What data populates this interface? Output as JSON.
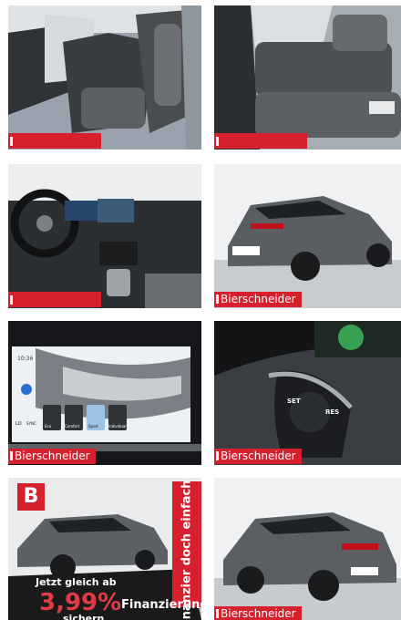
{
  "gallery": {
    "dealer_badge": "Bierschneider",
    "tiles": [
      {
        "name": "front-seats-photo",
        "badge": ""
      },
      {
        "name": "rear-seats-photo",
        "badge": ""
      },
      {
        "name": "dashboard-photo",
        "badge": ""
      },
      {
        "name": "car-rear-exterior-photo",
        "badge": "Bierschneider"
      },
      {
        "name": "infotainment-screen-photo",
        "badge": "Bierschneider"
      },
      {
        "name": "steering-wheel-buttons-photo",
        "badge": "Bierschneider"
      },
      {
        "name": "financing-promo-photo",
        "badge": ""
      },
      {
        "name": "car-rear-side-photo",
        "badge": "Bierschneider"
      }
    ]
  },
  "screen": {
    "clock": "10:36",
    "menu": [
      "Eco",
      "Comfort",
      "Sport",
      "Individual"
    ],
    "side": [
      "LO",
      "SYNC"
    ]
  },
  "wheel_buttons": [
    "SET",
    "RES"
  ],
  "promo": {
    "logo": "B",
    "side_text": "Finanzier doch einfach ...!",
    "line1": "Jetzt gleich ab",
    "rate": "3,99%",
    "line2": "Finanzierung",
    "line3": "sichern"
  },
  "colors": {
    "brand_red": "#d6202e"
  }
}
